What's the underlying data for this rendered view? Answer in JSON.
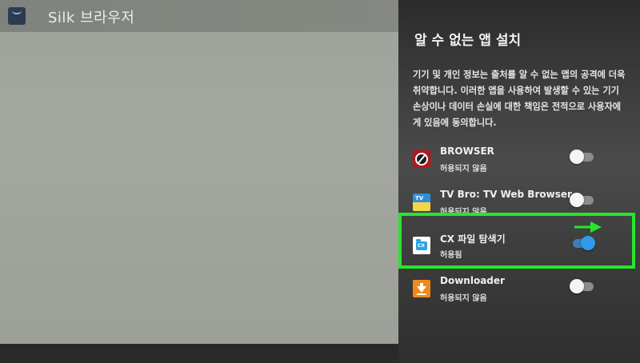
{
  "background_app": {
    "title": "Silk 브라우저"
  },
  "dialog": {
    "title": "알 수 없는 앱 설치",
    "description": "기기 및 개인 정보는 출처를 알 수 없는 앱의 공격에 더욱 취약합니다. 이러한 앱을 사용하여 발생할 수 있는 기기 손상이나 데이터 손실에 대한 책임은 전적으로 사용자에게 있음에 동의합니다.",
    "apps": [
      {
        "name": "BROWSER",
        "status": "허용되지 않음",
        "enabled": false,
        "icon": "browser-icon"
      },
      {
        "name": "TV Bro: TV Web Browser",
        "status": "허용되지 않음",
        "enabled": false,
        "icon": "tv-bro-icon"
      },
      {
        "name": "CX 파일 탐색기",
        "status": "허용됨",
        "enabled": true,
        "icon": "cx-file-explorer-icon"
      },
      {
        "name": "Downloader",
        "status": "허용되지 않음",
        "enabled": false,
        "icon": "downloader-icon"
      }
    ]
  },
  "annotation": {
    "highlight_color": "#27e62a"
  },
  "colors": {
    "toggle_on": "#2f9bea",
    "toggle_off": "#8c8c8c"
  }
}
